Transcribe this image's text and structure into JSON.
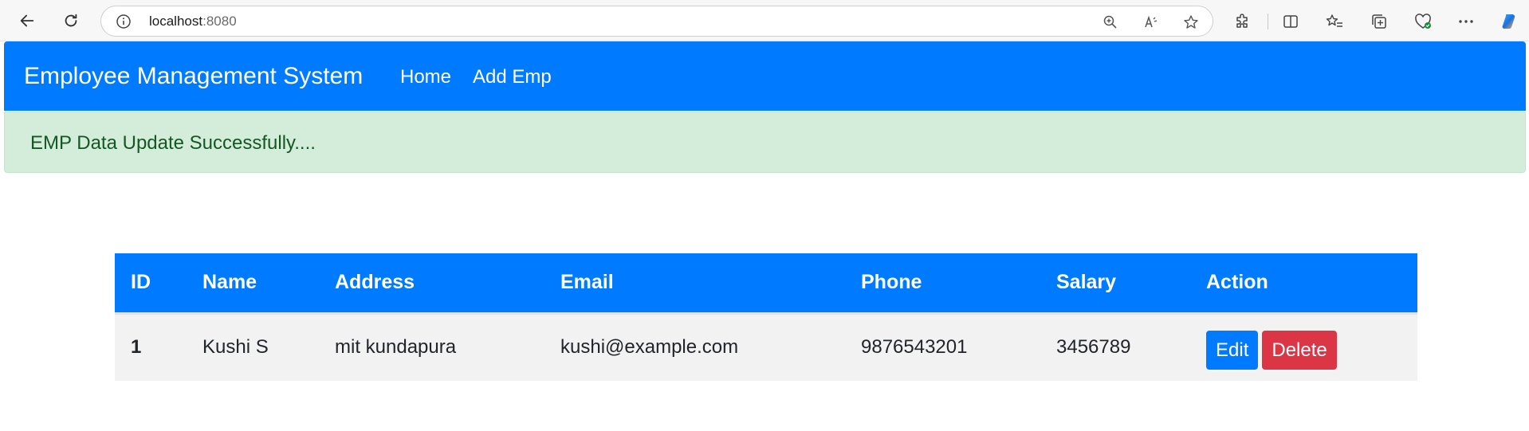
{
  "browser": {
    "url_host": "localhost",
    "url_port": ":8080",
    "icons": [
      "back-icon",
      "reload-icon",
      "info-icon",
      "zoom-icon",
      "read-aloud-icon",
      "favorite-star-icon",
      "extensions-icon",
      "split-screen-icon",
      "favorites-icon",
      "collections-icon",
      "browser-essentials-icon",
      "more-icon",
      "copilot-icon"
    ]
  },
  "navbar": {
    "brand": "Employee Management System",
    "links": [
      "Home",
      "Add Emp"
    ],
    "color": "#007bff"
  },
  "alert": {
    "message": "EMP Data Update Successfully....",
    "color": "#d4edda"
  },
  "table": {
    "headers": [
      "ID",
      "Name",
      "Address",
      "Email",
      "Phone",
      "Salary",
      "Action"
    ],
    "rows": [
      {
        "id": "1",
        "name": "Kushi S",
        "address": "mit kundapura",
        "email": "kushi@example.com",
        "phone": "9876543201",
        "salary": "3456789",
        "edit_label": "Edit",
        "delete_label": "Delete"
      }
    ]
  }
}
